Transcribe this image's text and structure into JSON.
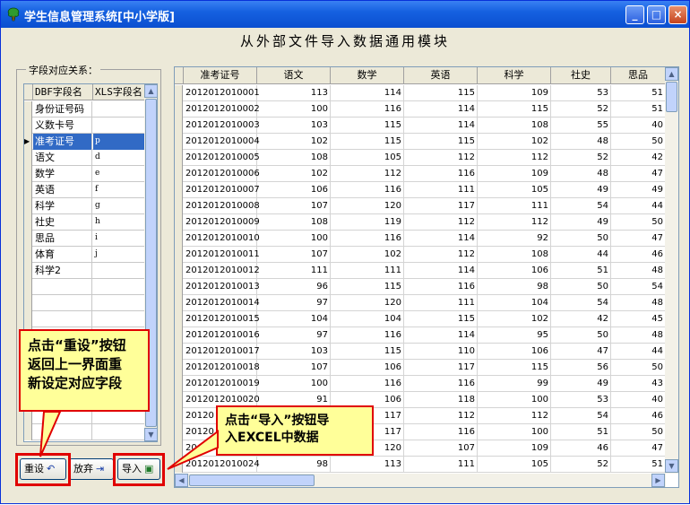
{
  "window": {
    "title": "学生信息管理系统[中小学版]",
    "minimize_label": "_",
    "maximize_label": "□",
    "close_label": "×"
  },
  "header": {
    "title": "从外部文件导入数据通用模块"
  },
  "left_panel": {
    "group_label": "字段对应关系：",
    "columns": [
      "DBF字段名",
      "XLS字段名"
    ],
    "rows": [
      {
        "dbf": "身份证号码",
        "xls": ""
      },
      {
        "dbf": "义数卡号",
        "xls": ""
      },
      {
        "dbf": "准考证号",
        "xls": "p"
      },
      {
        "dbf": "语文",
        "xls": "d"
      },
      {
        "dbf": "数学",
        "xls": "e"
      },
      {
        "dbf": "英语",
        "xls": "f"
      },
      {
        "dbf": "科学",
        "xls": "g"
      },
      {
        "dbf": "社史",
        "xls": "h"
      },
      {
        "dbf": "思品",
        "xls": "i"
      },
      {
        "dbf": "体育",
        "xls": "j"
      },
      {
        "dbf": "科学2",
        "xls": ""
      }
    ],
    "selected_index": 2
  },
  "right_panel": {
    "columns": [
      "准考证号",
      "语文",
      "数学",
      "英语",
      "科学",
      "社史",
      "思品"
    ],
    "rows": [
      [
        "2012012010001",
        "113",
        "114",
        "115",
        "109",
        "53",
        "51"
      ],
      [
        "2012012010002",
        "100",
        "116",
        "114",
        "115",
        "52",
        "51"
      ],
      [
        "2012012010003",
        "103",
        "115",
        "114",
        "108",
        "55",
        "40"
      ],
      [
        "2012012010004",
        "102",
        "115",
        "115",
        "102",
        "48",
        "50"
      ],
      [
        "2012012010005",
        "108",
        "105",
        "112",
        "112",
        "52",
        "42"
      ],
      [
        "2012012010006",
        "102",
        "112",
        "116",
        "109",
        "48",
        "47"
      ],
      [
        "2012012010007",
        "106",
        "116",
        "111",
        "105",
        "49",
        "49"
      ],
      [
        "2012012010008",
        "107",
        "120",
        "117",
        "111",
        "54",
        "44"
      ],
      [
        "2012012010009",
        "108",
        "119",
        "112",
        "112",
        "49",
        "50"
      ],
      [
        "2012012010010",
        "100",
        "116",
        "114",
        "92",
        "50",
        "47"
      ],
      [
        "2012012010011",
        "107",
        "102",
        "112",
        "108",
        "44",
        "46"
      ],
      [
        "2012012010012",
        "111",
        "111",
        "114",
        "106",
        "51",
        "48"
      ],
      [
        "2012012010013",
        "96",
        "115",
        "116",
        "98",
        "50",
        "54"
      ],
      [
        "2012012010014",
        "97",
        "120",
        "111",
        "104",
        "54",
        "48"
      ],
      [
        "2012012010015",
        "104",
        "104",
        "115",
        "102",
        "42",
        "45"
      ],
      [
        "2012012010016",
        "97",
        "116",
        "114",
        "95",
        "50",
        "48"
      ],
      [
        "2012012010017",
        "103",
        "115",
        "110",
        "106",
        "47",
        "44"
      ],
      [
        "2012012010018",
        "107",
        "106",
        "117",
        "115",
        "56",
        "50"
      ],
      [
        "2012012010019",
        "100",
        "116",
        "116",
        "99",
        "49",
        "43"
      ],
      [
        "2012012010020",
        "91",
        "106",
        "118",
        "100",
        "53",
        "40"
      ],
      [
        "20120",
        "",
        "117",
        "112",
        "112",
        "54",
        "46"
      ],
      [
        "20120",
        "",
        "117",
        "116",
        "100",
        "51",
        "50"
      ],
      [
        "20",
        "",
        "120",
        "107",
        "109",
        "46",
        "47"
      ],
      [
        "2012012010024",
        "98",
        "113",
        "111",
        "105",
        "52",
        "51"
      ]
    ]
  },
  "buttons": {
    "reset": "重设",
    "abandon": "放弃",
    "import": "导入"
  },
  "callouts": {
    "reset_lines": [
      "点击“重设”按钮",
      "返回上一界面重",
      "新设定对应字段"
    ],
    "import_lines": [
      "点击“导入”按钮导",
      "入EXCEL中数据"
    ]
  },
  "colors": {
    "titlebar": "#0b4fd0",
    "selection": "#316ac5",
    "callout_bg": "#ffff99",
    "highlight_red": "#e00000"
  }
}
